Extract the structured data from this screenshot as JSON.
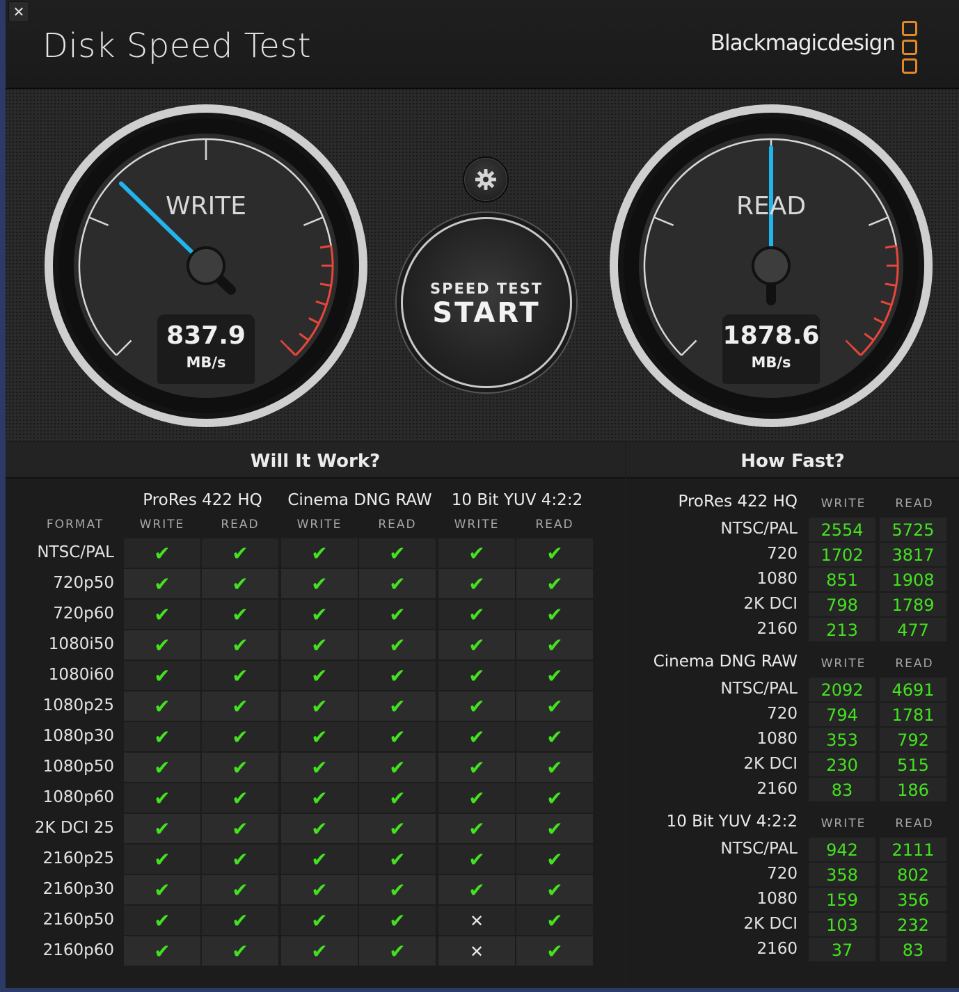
{
  "window": {
    "close_label": "✕",
    "title": "Disk Speed Test",
    "brand": "Blackmagicdesign",
    "brand_color": "#e0882a"
  },
  "gauges": {
    "write": {
      "label": "WRITE",
      "value": "837.9",
      "unit": "MB/s",
      "needle_fraction": 0.33
    },
    "read": {
      "label": "READ",
      "value": "1878.6",
      "unit": "MB/s",
      "needle_fraction": 0.5
    }
  },
  "settings_icon": "gear-icon",
  "start_button": {
    "top": "SPEED TEST",
    "main": "START"
  },
  "will_it_work": {
    "title": "Will It Work?",
    "format_header": "FORMAT",
    "groups": [
      "ProRes 422 HQ",
      "Cinema DNG RAW",
      "10 Bit YUV 4:2:2"
    ],
    "sub_headers": [
      "WRITE",
      "READ"
    ],
    "rows": [
      {
        "format": "NTSC/PAL",
        "marks": [
          "✔",
          "✔",
          "✔",
          "✔",
          "✔",
          "✔"
        ]
      },
      {
        "format": "720p50",
        "marks": [
          "✔",
          "✔",
          "✔",
          "✔",
          "✔",
          "✔"
        ]
      },
      {
        "format": "720p60",
        "marks": [
          "✔",
          "✔",
          "✔",
          "✔",
          "✔",
          "✔"
        ]
      },
      {
        "format": "1080i50",
        "marks": [
          "✔",
          "✔",
          "✔",
          "✔",
          "✔",
          "✔"
        ]
      },
      {
        "format": "1080i60",
        "marks": [
          "✔",
          "✔",
          "✔",
          "✔",
          "✔",
          "✔"
        ]
      },
      {
        "format": "1080p25",
        "marks": [
          "✔",
          "✔",
          "✔",
          "✔",
          "✔",
          "✔"
        ]
      },
      {
        "format": "1080p30",
        "marks": [
          "✔",
          "✔",
          "✔",
          "✔",
          "✔",
          "✔"
        ]
      },
      {
        "format": "1080p50",
        "marks": [
          "✔",
          "✔",
          "✔",
          "✔",
          "✔",
          "✔"
        ]
      },
      {
        "format": "1080p60",
        "marks": [
          "✔",
          "✔",
          "✔",
          "✔",
          "✔",
          "✔"
        ]
      },
      {
        "format": "2K DCI 25",
        "marks": [
          "✔",
          "✔",
          "✔",
          "✔",
          "✔",
          "✔"
        ]
      },
      {
        "format": "2160p25",
        "marks": [
          "✔",
          "✔",
          "✔",
          "✔",
          "✔",
          "✔"
        ]
      },
      {
        "format": "2160p30",
        "marks": [
          "✔",
          "✔",
          "✔",
          "✔",
          "✔",
          "✔"
        ]
      },
      {
        "format": "2160p50",
        "marks": [
          "✔",
          "✔",
          "✔",
          "✔",
          "✕",
          "✔"
        ]
      },
      {
        "format": "2160p60",
        "marks": [
          "✔",
          "✔",
          "✔",
          "✔",
          "✕",
          "✔"
        ]
      }
    ],
    "ok_color": "#43e21f"
  },
  "how_fast": {
    "title": "How Fast?",
    "sub_headers": [
      "WRITE",
      "READ"
    ],
    "groups": [
      {
        "name": "ProRes 422 HQ",
        "rows": [
          {
            "label": "NTSC/PAL",
            "write": "2554",
            "read": "5725"
          },
          {
            "label": "720",
            "write": "1702",
            "read": "3817"
          },
          {
            "label": "1080",
            "write": "851",
            "read": "1908"
          },
          {
            "label": "2K DCI",
            "write": "798",
            "read": "1789"
          },
          {
            "label": "2160",
            "write": "213",
            "read": "477"
          }
        ]
      },
      {
        "name": "Cinema DNG RAW",
        "rows": [
          {
            "label": "NTSC/PAL",
            "write": "2092",
            "read": "4691"
          },
          {
            "label": "720",
            "write": "794",
            "read": "1781"
          },
          {
            "label": "1080",
            "write": "353",
            "read": "792"
          },
          {
            "label": "2K DCI",
            "write": "230",
            "read": "515"
          },
          {
            "label": "2160",
            "write": "83",
            "read": "186"
          }
        ]
      },
      {
        "name": "10 Bit YUV 4:2:2",
        "rows": [
          {
            "label": "NTSC/PAL",
            "write": "942",
            "read": "2111"
          },
          {
            "label": "720",
            "write": "358",
            "read": "802"
          },
          {
            "label": "1080",
            "write": "159",
            "read": "356"
          },
          {
            "label": "2K DCI",
            "write": "103",
            "read": "232"
          },
          {
            "label": "2160",
            "write": "37",
            "read": "83"
          }
        ]
      }
    ]
  }
}
